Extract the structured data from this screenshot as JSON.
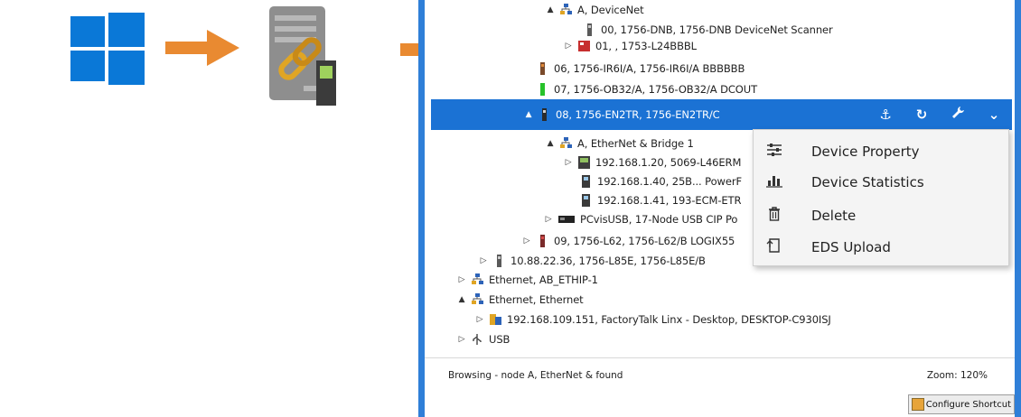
{
  "illustration": {
    "windows_logo": "windows-logo-icon",
    "arrow_1": "arrow-right-icon",
    "server_link": "server-link-icon",
    "arrow_2": "arrow-right-icon"
  },
  "tree": {
    "rows": [
      {
        "label": "A, DeviceNet",
        "icon": "network-icon",
        "toggle": "▲"
      },
      {
        "label": "00, 1756-DNB, 1756-DNB DeviceNet Scanner",
        "icon": "module-icon",
        "toggle": ""
      },
      {
        "label": "01, , 1753-L24BBBL",
        "icon": "module-red-icon",
        "toggle": "▷"
      },
      {
        "label": "06, 1756-IR6I/A, 1756-IR6I/A BBBBBB",
        "icon": "module-icon",
        "toggle": ""
      },
      {
        "label": "07, 1756-OB32/A, 1756-OB32/A   DCOUT",
        "icon": "module-green-icon",
        "toggle": ""
      },
      {
        "label": "08, 1756-EN2TR, 1756-EN2TR/C",
        "icon": "module-icon",
        "toggle": "▲"
      },
      {
        "label": "A, EtherNet & Bridge 1",
        "icon": "network-icon",
        "toggle": "▲"
      },
      {
        "label": "192.168.1.20, 5069-L46ERM",
        "icon": "controller-icon",
        "toggle": "▷"
      },
      {
        "label": "192.168.1.40, 25B... PowerF",
        "icon": "drive-icon",
        "toggle": ""
      },
      {
        "label": "192.168.1.41, 193-ECM-ETR",
        "icon": "drive-icon",
        "toggle": ""
      },
      {
        "label": "PCvisUSB, 17-Node USB CIP Po",
        "icon": "usb-device-icon",
        "toggle": "▷"
      },
      {
        "label": "09, 1756-L62, 1756-L62/B LOGIX55",
        "icon": "module-icon",
        "toggle": "▷"
      },
      {
        "label": "10.88.22.36, 1756-L85E, 1756-L85E/B",
        "icon": "module-icon",
        "toggle": "▷"
      },
      {
        "label": "Ethernet, AB_ETHIP-1",
        "icon": "network-icon",
        "toggle": "▷"
      },
      {
        "label": "Ethernet, Ethernet",
        "icon": "network-icon",
        "toggle": "▲"
      },
      {
        "label": "192.168.109.151, FactoryTalk Linx - Desktop, DESKTOP-C930ISJ",
        "icon": "factorytalk-icon",
        "toggle": "▷"
      },
      {
        "label": "USB",
        "icon": "usb-icon",
        "toggle": "▷"
      }
    ],
    "selected_tools": {
      "anchor": "⚓",
      "refresh": "↻",
      "wrench": "🔧",
      "dropdown": "⌄"
    }
  },
  "context_menu": {
    "items": [
      {
        "label": "Device Property",
        "icon": "sliders-icon",
        "glyph": "☰"
      },
      {
        "label": "Device Statistics",
        "icon": "bar-chart-icon",
        "glyph": "📊"
      },
      {
        "label": "Delete",
        "icon": "trash-icon",
        "glyph": "🗑"
      },
      {
        "label": "EDS Upload",
        "icon": "upload-icon",
        "glyph": "⇪"
      }
    ]
  },
  "status": {
    "left": "Browsing - node A, EtherNet & found",
    "right": "Zoom: 120%",
    "shortcut": "Configure Shortcut"
  }
}
